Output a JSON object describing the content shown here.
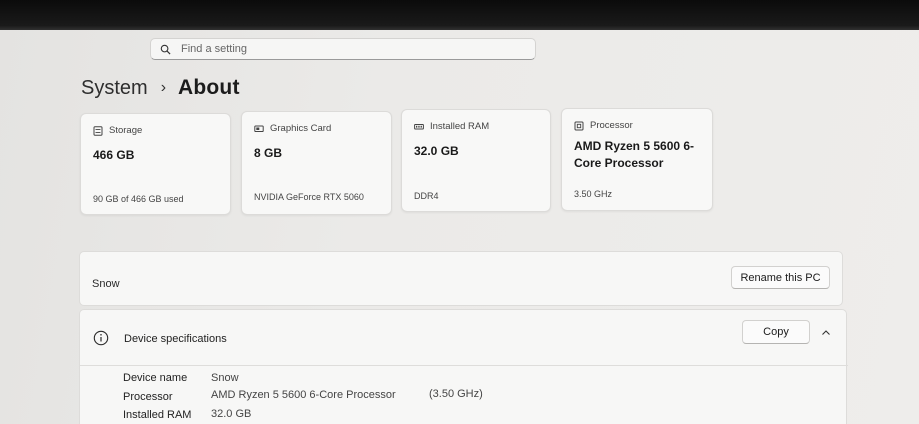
{
  "search": {
    "placeholder": "Find a setting"
  },
  "breadcrumb": {
    "root": "System",
    "separator": "›",
    "current": "About"
  },
  "cards": [
    {
      "title": "Storage",
      "icon": "storage-icon",
      "value": "466 GB",
      "sub": "90 GB of 466 GB used"
    },
    {
      "title": "Graphics Card",
      "icon": "graphics-card-icon",
      "value": "8 GB",
      "sub": "NVIDIA GeForce RTX 5060"
    },
    {
      "title": "Installed RAM",
      "icon": "ram-icon",
      "value": "32.0 GB",
      "sub": "DDR4"
    },
    {
      "title": "Processor",
      "icon": "processor-icon",
      "value_line1": "AMD Ryzen 5 5600 6-",
      "value_line2": "Core Processor",
      "sub": "3.50 GHz"
    }
  ],
  "pc": {
    "name": "Snow",
    "rename_label": "Rename this PC"
  },
  "specs": {
    "title": "Device specifications",
    "copy_label": "Copy",
    "rows": [
      {
        "label": "Device name",
        "value": "Snow",
        "extra": ""
      },
      {
        "label": "Processor",
        "value": "AMD Ryzen 5 5600 6-Core Processor",
        "extra": "(3.50 GHz)"
      },
      {
        "label": "Installed RAM",
        "value": "32.0 GB",
        "extra": ""
      }
    ]
  },
  "colors": {
    "background": "#ebeae8",
    "card": "#f8f8f7",
    "bezel": "#111111"
  }
}
